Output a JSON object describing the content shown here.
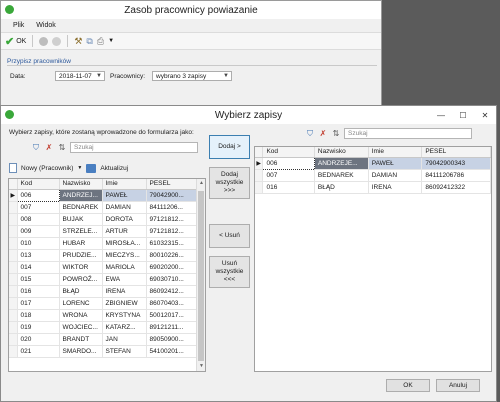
{
  "main_window": {
    "title": "Zasob pracownicy powiazanie",
    "menu": [
      "Plik",
      "Widok"
    ],
    "toolbar": {
      "ok_label": "OK"
    },
    "group_title": "Przypisz pracowników",
    "date_label": "Data:",
    "date_value": "2018-11-07",
    "employees_label": "Pracownicy:",
    "employees_value": "wybrano 3 zapisy"
  },
  "dialog": {
    "title": "Wybierz zapisy",
    "instruction": "Wybierz zapisy, które zostaną wprowadzone do formularza jako:",
    "left_search_placeholder": "Szukaj",
    "right_search_placeholder": "Szukaj",
    "new_button": "Nowy (Pracownik)",
    "update_button": "Aktualizuj",
    "columns": [
      "Kod",
      "Nazwisko",
      "Imie",
      "PESEL"
    ],
    "left_rows": [
      [
        "006",
        "ANDRZEJ...",
        "PAWEŁ",
        "79042900..."
      ],
      [
        "007",
        "BEDNAREK",
        "DAMIAN",
        "84111206..."
      ],
      [
        "008",
        "BUJAK",
        "DOROTA",
        "97121812..."
      ],
      [
        "009",
        "STRZELE...",
        "ARTUR",
        "97121812..."
      ],
      [
        "010",
        "HUBAR",
        "MIROSŁA...",
        "61032315..."
      ],
      [
        "013",
        "PRUDZIE...",
        "MIECZYS...",
        "80010226..."
      ],
      [
        "014",
        "WIKTOR",
        "MARIOLA",
        "69020200..."
      ],
      [
        "015",
        "POWROŹ...",
        "EWA",
        "69030710..."
      ],
      [
        "016",
        "BŁĄD",
        "IRENA",
        "86092412..."
      ],
      [
        "017",
        "LORENC",
        "ZBIGNIEW",
        "86070403..."
      ],
      [
        "018",
        "WRONA",
        "KRYSTYNA",
        "50012017..."
      ],
      [
        "019",
        "WOJCIEC...",
        "KATARZ...",
        "89121211..."
      ],
      [
        "020",
        "BRANDT",
        "JAN",
        "89050900..."
      ],
      [
        "021",
        "SMARDO...",
        "STEFAN",
        "54100201..."
      ]
    ],
    "right_rows": [
      [
        "006",
        "ANDRZEJE...",
        "PAWEŁ",
        "79042900343"
      ],
      [
        "007",
        "BEDNAREK",
        "DAMIAN",
        "84111206786"
      ],
      [
        "016",
        "BŁĄD",
        "IRENA",
        "86092412322"
      ]
    ],
    "add_button": "Dodaj >",
    "add_all_button": "Dodaj\nwszystkie\n>>>",
    "remove_button": "< Usuń",
    "remove_all_button": "Usuń\nwszystkie\n<<<",
    "ok_button": "OK",
    "cancel_button": "Anuluj"
  }
}
